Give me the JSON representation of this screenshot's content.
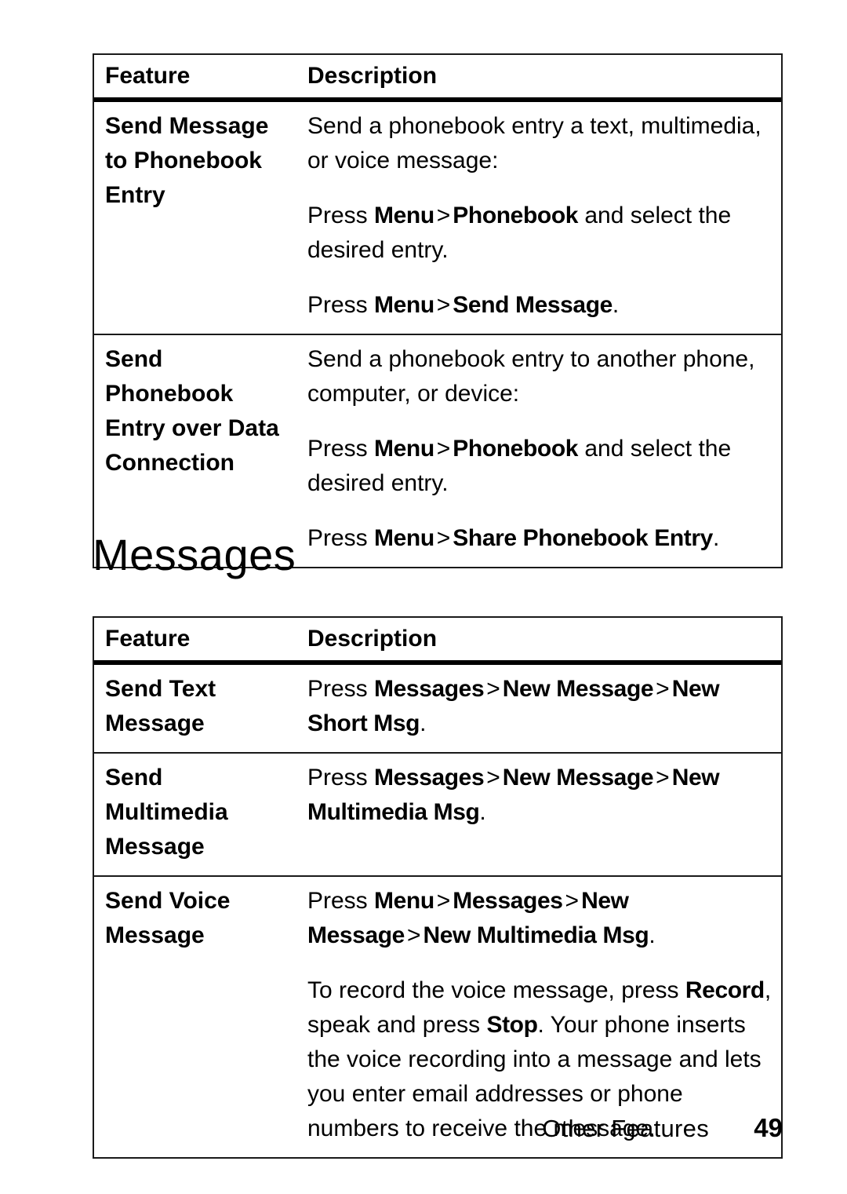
{
  "page": {
    "section_heading": "Messages",
    "footer": {
      "section_label": "Other Features",
      "page_number": "49"
    }
  },
  "tables": [
    {
      "id": "table-phonebook",
      "headers": {
        "feature": "Feature",
        "description": "Description"
      },
      "rows": [
        {
          "feature": "Send Message\nto Phonebook\nEntry",
          "paragraphs": [
            {
              "runs": [
                {
                  "text": "Send a phonebook entry a text, multimedia, or voice message:",
                  "bold": false
                }
              ]
            },
            {
              "runs": [
                {
                  "text": "Press ",
                  "bold": false
                },
                {
                  "text": "Menu",
                  "bold": true
                },
                {
                  "text": ">",
                  "bold": false,
                  "sep": true
                },
                {
                  "text": "Phonebook",
                  "bold": true
                },
                {
                  "text": " and select the desired entry.",
                  "bold": false
                }
              ]
            },
            {
              "runs": [
                {
                  "text": "Press ",
                  "bold": false
                },
                {
                  "text": "Menu",
                  "bold": true
                },
                {
                  "text": ">",
                  "bold": false,
                  "sep": true
                },
                {
                  "text": "Send Message",
                  "bold": true
                },
                {
                  "text": ".",
                  "bold": false
                }
              ]
            }
          ]
        },
        {
          "feature": "Send\nPhonebook\nEntry over Data\nConnection",
          "paragraphs": [
            {
              "runs": [
                {
                  "text": "Send a phonebook entry to another phone, computer, or device:",
                  "bold": false
                }
              ]
            },
            {
              "runs": [
                {
                  "text": "Press ",
                  "bold": false
                },
                {
                  "text": "Menu",
                  "bold": true
                },
                {
                  "text": ">",
                  "bold": false,
                  "sep": true
                },
                {
                  "text": "Phonebook",
                  "bold": true
                },
                {
                  "text": " and select the desired entry.",
                  "bold": false
                }
              ]
            },
            {
              "runs": [
                {
                  "text": "Press ",
                  "bold": false
                },
                {
                  "text": "Menu",
                  "bold": true
                },
                {
                  "text": ">",
                  "bold": false,
                  "sep": true
                },
                {
                  "text": "Share Phonebook Entry",
                  "bold": true
                },
                {
                  "text": ".",
                  "bold": false
                }
              ]
            }
          ]
        }
      ]
    },
    {
      "id": "table-messages",
      "headers": {
        "feature": "Feature",
        "description": "Description"
      },
      "rows": [
        {
          "feature": "Send Text\nMessage",
          "paragraphs": [
            {
              "runs": [
                {
                  "text": "Press ",
                  "bold": false
                },
                {
                  "text": "Messages",
                  "bold": true
                },
                {
                  "text": ">",
                  "bold": false,
                  "sep": true
                },
                {
                  "text": "New Message",
                  "bold": true
                },
                {
                  "text": ">",
                  "bold": false,
                  "sep": true
                },
                {
                  "text": "New Short Msg",
                  "bold": true
                },
                {
                  "text": ".",
                  "bold": false
                }
              ]
            }
          ]
        },
        {
          "feature": "Send\nMultimedia\nMessage",
          "paragraphs": [
            {
              "runs": [
                {
                  "text": "Press ",
                  "bold": false
                },
                {
                  "text": "Messages",
                  "bold": true
                },
                {
                  "text": ">",
                  "bold": false,
                  "sep": true
                },
                {
                  "text": "New Message",
                  "bold": true
                },
                {
                  "text": ">",
                  "bold": false,
                  "sep": true
                },
                {
                  "text": "New Multimedia Msg",
                  "bold": true
                },
                {
                  "text": ".",
                  "bold": false
                }
              ]
            }
          ]
        },
        {
          "feature": "Send Voice\nMessage",
          "paragraphs": [
            {
              "runs": [
                {
                  "text": "Press ",
                  "bold": false
                },
                {
                  "text": "Menu",
                  "bold": true
                },
                {
                  "text": ">",
                  "bold": false,
                  "sep": true
                },
                {
                  "text": "Messages",
                  "bold": true
                },
                {
                  "text": ">",
                  "bold": false,
                  "sep": true
                },
                {
                  "text": "New Message",
                  "bold": true
                },
                {
                  "text": ">",
                  "bold": false,
                  "sep": true
                },
                {
                  "text": "New Multimedia Msg",
                  "bold": true
                },
                {
                  "text": ".",
                  "bold": false
                }
              ]
            },
            {
              "runs": [
                {
                  "text": "To record the voice message, press ",
                  "bold": false
                },
                {
                  "text": "Record",
                  "bold": true
                },
                {
                  "text": ", speak and press ",
                  "bold": false
                },
                {
                  "text": "Stop",
                  "bold": true
                },
                {
                  "text": ". Your phone inserts the voice recording into a message and lets you enter email addresses or phone numbers to receive the message.",
                  "bold": false
                }
              ]
            }
          ]
        }
      ]
    }
  ]
}
